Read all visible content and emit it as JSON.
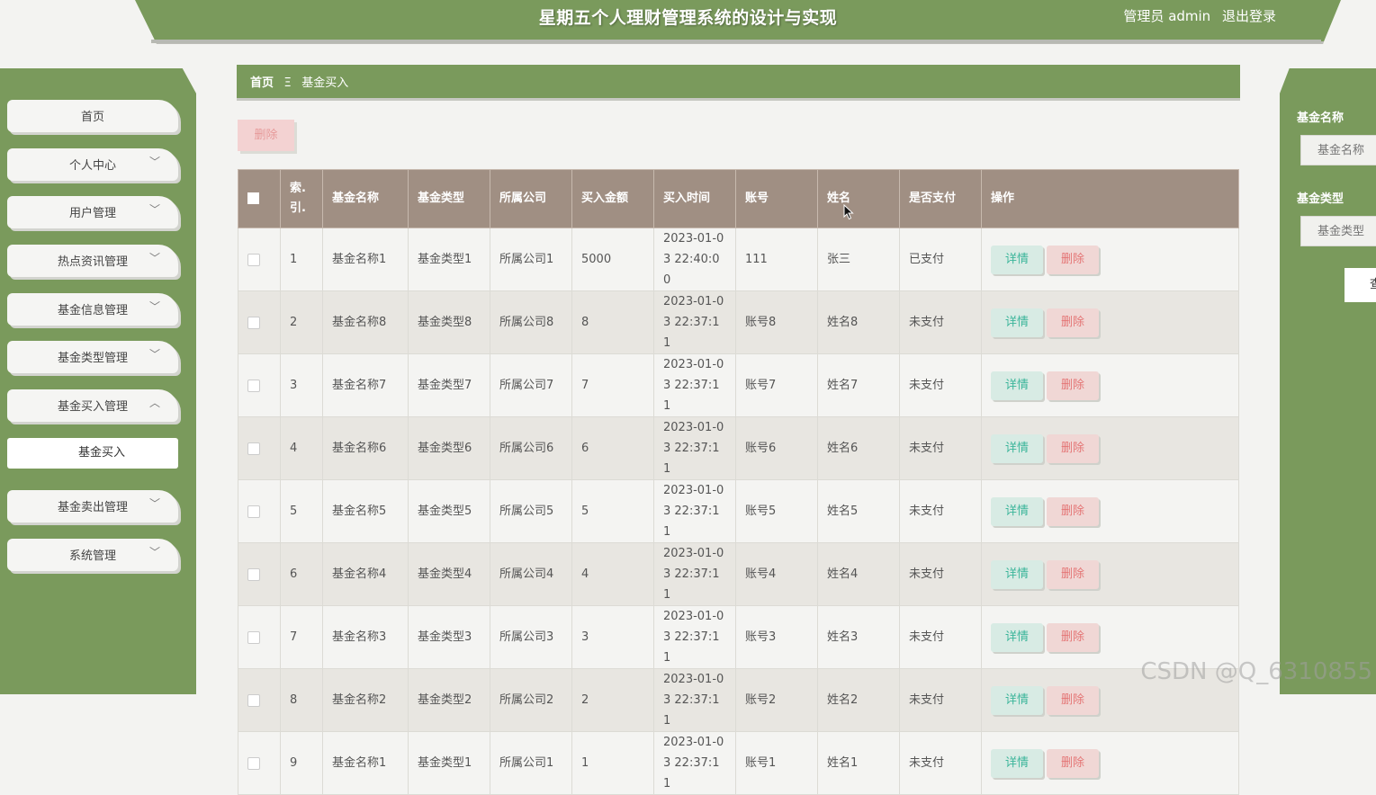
{
  "header": {
    "title": "星期五个人理财管理系统的设计与实现",
    "admin_label": "管理员 admin",
    "logout_label": "退出登录"
  },
  "sidebar": {
    "items": [
      {
        "label": "首页",
        "has_chevron": false
      },
      {
        "label": "个人中心",
        "chevron": "﹀"
      },
      {
        "label": "用户管理",
        "chevron": "﹀"
      },
      {
        "label": "热点资讯管理",
        "chevron": "﹀"
      },
      {
        "label": "基金信息管理",
        "chevron": "﹀"
      },
      {
        "label": "基金类型管理",
        "chevron": "﹀"
      },
      {
        "label": "基金买入管理",
        "chevron": "︿"
      },
      {
        "label": "基金卖出管理",
        "chevron": "﹀"
      },
      {
        "label": "系统管理",
        "chevron": "﹀"
      }
    ],
    "active_sub": "基金买入"
  },
  "breadcrumb": {
    "home": "首页",
    "separator": "Ξ",
    "current": "基金买入"
  },
  "toolbar": {
    "delete_label": "删除"
  },
  "table": {
    "headers": [
      "索引",
      "基金名称",
      "基金类型",
      "所属公司",
      "买入金额",
      "买入时间",
      "账号",
      "姓名",
      "是否支付",
      "操作"
    ],
    "headers_display": {
      "index": "索.引.",
      "name": "基金名称",
      "type": "基金类型",
      "company": "所属公司",
      "amount": "买入金额",
      "time": "买入时间",
      "account": "账号",
      "username": "姓名",
      "paid": "是否支付",
      "ops": "操作"
    },
    "rows": [
      {
        "idx": "1",
        "name": "基金名称1",
        "type": "基金类型1",
        "company": "所属公司1",
        "amount": "5000",
        "time": "2023-01-03 22:40:00",
        "account": "111",
        "username": "张三",
        "paid": "已支付"
      },
      {
        "idx": "2",
        "name": "基金名称8",
        "type": "基金类型8",
        "company": "所属公司8",
        "amount": "8",
        "time": "2023-01-03 22:37:11",
        "account": "账号8",
        "username": "姓名8",
        "paid": "未支付"
      },
      {
        "idx": "3",
        "name": "基金名称7",
        "type": "基金类型7",
        "company": "所属公司7",
        "amount": "7",
        "time": "2023-01-03 22:37:11",
        "account": "账号7",
        "username": "姓名7",
        "paid": "未支付"
      },
      {
        "idx": "4",
        "name": "基金名称6",
        "type": "基金类型6",
        "company": "所属公司6",
        "amount": "6",
        "time": "2023-01-03 22:37:11",
        "account": "账号6",
        "username": "姓名6",
        "paid": "未支付"
      },
      {
        "idx": "5",
        "name": "基金名称5",
        "type": "基金类型5",
        "company": "所属公司5",
        "amount": "5",
        "time": "2023-01-03 22:37:11",
        "account": "账号5",
        "username": "姓名5",
        "paid": "未支付"
      },
      {
        "idx": "6",
        "name": "基金名称4",
        "type": "基金类型4",
        "company": "所属公司4",
        "amount": "4",
        "time": "2023-01-03 22:37:11",
        "account": "账号4",
        "username": "姓名4",
        "paid": "未支付"
      },
      {
        "idx": "7",
        "name": "基金名称3",
        "type": "基金类型3",
        "company": "所属公司3",
        "amount": "3",
        "time": "2023-01-03 22:37:11",
        "account": "账号3",
        "username": "姓名3",
        "paid": "未支付"
      },
      {
        "idx": "8",
        "name": "基金名称2",
        "type": "基金类型2",
        "company": "所属公司2",
        "amount": "2",
        "time": "2023-01-03 22:37:11",
        "account": "账号2",
        "username": "姓名2",
        "paid": "未支付"
      },
      {
        "idx": "9",
        "name": "基金名称1",
        "type": "基金类型1",
        "company": "所属公司1",
        "amount": "1",
        "time": "2023-01-03 22:37:11",
        "account": "账号1",
        "username": "姓名1",
        "paid": "未支付"
      }
    ],
    "detail_label": "详情",
    "delete_label": "删除"
  },
  "search": {
    "fund_name_label": "基金名称",
    "fund_name_placeholder": "基金名称",
    "fund_type_label": "基金类型",
    "fund_type_placeholder": "基金类型",
    "query_label": "查"
  },
  "watermark": "CSDN @Q_6310855",
  "colors": {
    "primary_green": "#7a9a5c",
    "table_header": "#a08f83",
    "detail_text": "#3bb59a",
    "delete_text": "#e47575"
  }
}
